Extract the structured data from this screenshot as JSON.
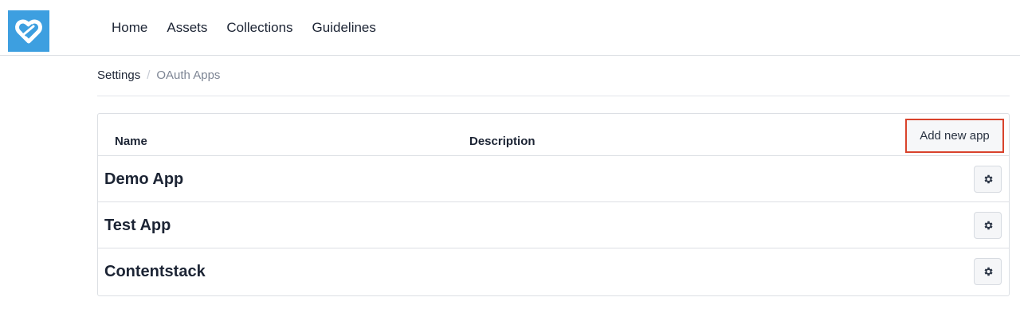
{
  "brand": {
    "logo_icon": "link-heart-logo-icon",
    "color": "#3d9fe0"
  },
  "nav": [
    {
      "label": "Home"
    },
    {
      "label": "Assets"
    },
    {
      "label": "Collections"
    },
    {
      "label": "Guidelines"
    }
  ],
  "breadcrumb": {
    "parent": "Settings",
    "separator": "/",
    "current": "OAuth Apps"
  },
  "table": {
    "columns": {
      "name": "Name",
      "description": "Description"
    },
    "add_button_label": "Add new app",
    "rows": [
      {
        "name": "Demo App",
        "description": "",
        "action_icon": "gear-icon"
      },
      {
        "name": "Test App",
        "description": "",
        "action_icon": "gear-icon"
      },
      {
        "name": "Contentstack",
        "description": "",
        "action_icon": "gear-icon"
      }
    ]
  },
  "colors": {
    "highlight": "#d9432c",
    "text": "#1c2434",
    "muted": "#7d8594"
  }
}
